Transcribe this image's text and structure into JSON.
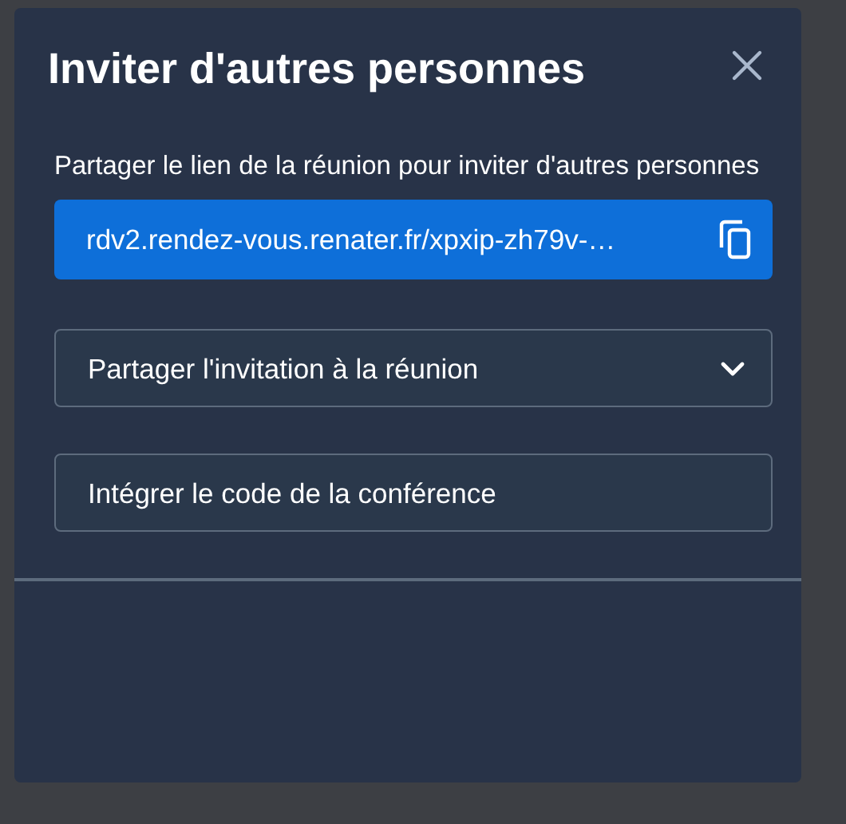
{
  "dialog": {
    "title": "Inviter d'autres personnes"
  },
  "link_section": {
    "label": "Partager le lien de la réunion pour inviter d'autres personnes",
    "link": "rdv2.rendez-vous.renater.fr/xpxip-zh79v-…"
  },
  "invite_dropdown": {
    "label": "Partager l'invitation à la réunion",
    "expanded": false
  },
  "embed_button": {
    "label": "Intégrer le code de la conférence"
  }
}
